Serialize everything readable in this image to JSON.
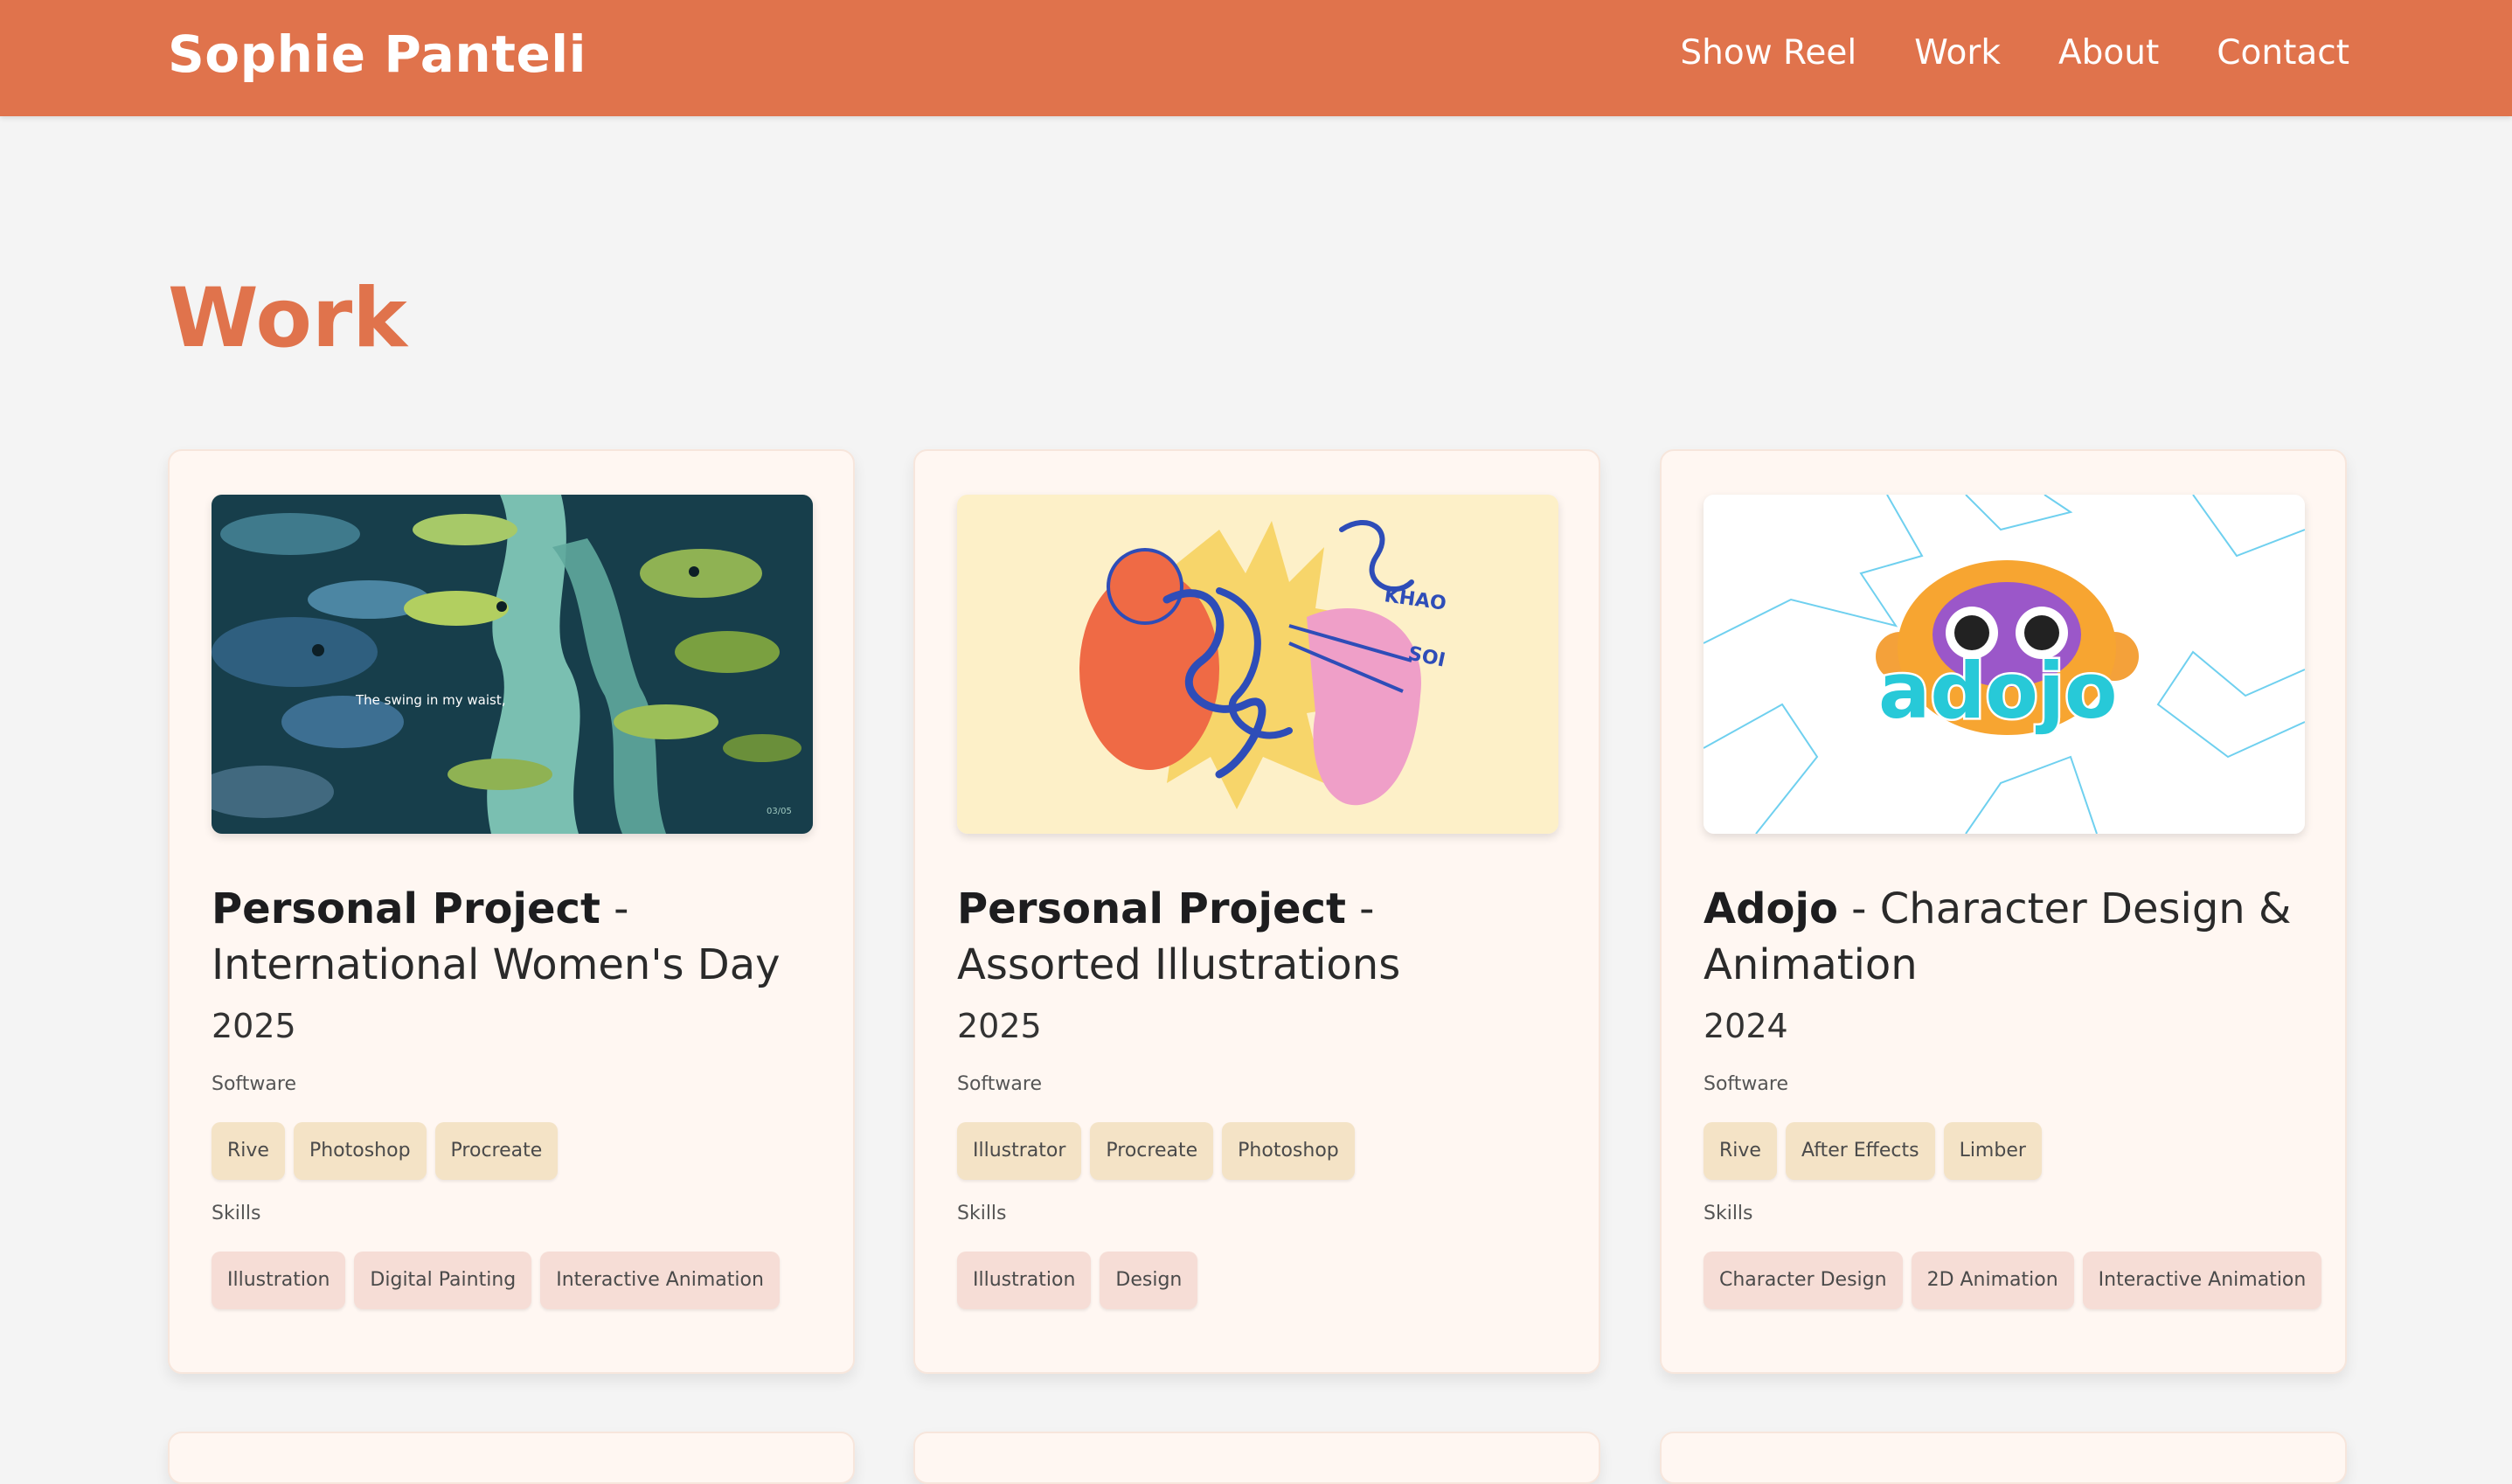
{
  "header": {
    "brand": "Sophie Panteli",
    "nav": [
      "Show Reel",
      "Work",
      "About",
      "Contact"
    ]
  },
  "page": {
    "title": "Work"
  },
  "projects": [
    {
      "title_strong": "Personal Project",
      "title_rest": " - International Women's Day",
      "year": "2025",
      "software_label": "Software",
      "software": [
        "Rive",
        "Photoshop",
        "Procreate"
      ],
      "skills_label": "Skills",
      "skills": [
        "Illustration",
        "Digital Painting",
        "Interactive Animation"
      ],
      "thumb_caption": "The swing in my waist,",
      "thumb_counter": "03/05"
    },
    {
      "title_strong": "Personal Project",
      "title_rest": " - Assorted Illustrations",
      "year": "2025",
      "software_label": "Software",
      "software": [
        "Illustrator",
        "Procreate",
        "Photoshop"
      ],
      "skills_label": "Skills",
      "skills": [
        "Illustration",
        "Design"
      ],
      "thumb_text_1": "KHAO",
      "thumb_text_2": "SOI"
    },
    {
      "title_strong": "Adojo",
      "title_rest": " - Character Design & Animation",
      "year": "2024",
      "software_label": "Software",
      "software": [
        "Rive",
        "After Effects",
        "Limber"
      ],
      "skills_label": "Skills",
      "skills": [
        "Character Design",
        "2D Animation",
        "Interactive Animation"
      ],
      "thumb_logo": "adojo"
    }
  ],
  "colors": {
    "accent": "#e0734c",
    "background": "#f4f4f4",
    "card": "#fff7f2",
    "software_tag": "#f4e3c6",
    "skill_tag": "#f6ddd6"
  }
}
